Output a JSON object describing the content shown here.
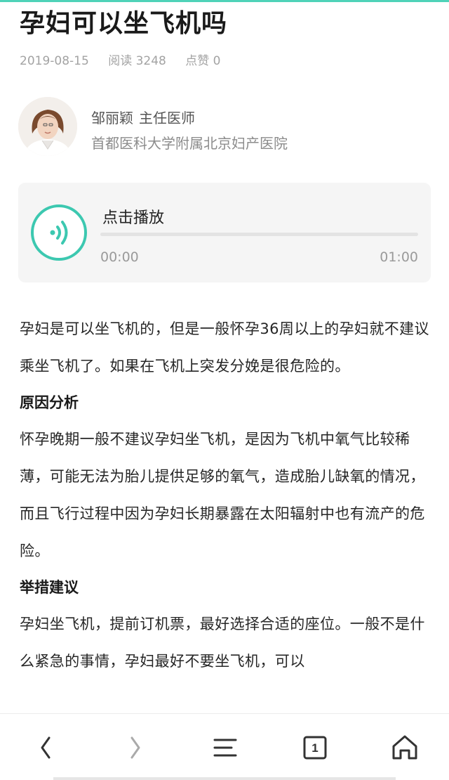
{
  "article": {
    "title": "孕妇可以坐飞机吗",
    "date": "2019-08-15",
    "reads": "阅读 3248",
    "likes": "点赞 0"
  },
  "author": {
    "name": "邹丽颖",
    "role": "主任医师",
    "hospital": "首都医科大学附属北京妇产医院"
  },
  "audio": {
    "label": "点击播放",
    "current_time": "00:00",
    "duration": "01:00",
    "progress": 0,
    "accent_color": "#3cc8b0",
    "icon": "sound-wave-icon"
  },
  "content": {
    "intro": "孕妇是可以坐飞机的，但是一般怀孕36周以上的孕妇就不建议乘坐飞机了。如果在飞机上突发分娩是很危险的。",
    "section1_heading": "原因分析",
    "section1_text": "怀孕晚期一般不建议孕妇坐飞机，是因为飞机中氧气比较稀薄，可能无法为胎儿提供足够的氧气，造成胎儿缺氧的情况，而且飞行过程中因为孕妇长期暴露在太阳辐射中也有流产的危险。",
    "section2_heading": "举措建议",
    "section2_text": "孕妇坐飞机，提前订机票，最好选择合适的座位。一般不是什么紧急的事情，孕妇最好不要坐飞机，可以"
  },
  "bottom_nav": {
    "icons": [
      "back-chevron-icon",
      "forward-chevron-icon",
      "menu-icon",
      "tabs-icon",
      "home-icon"
    ],
    "tab_count": "1"
  }
}
